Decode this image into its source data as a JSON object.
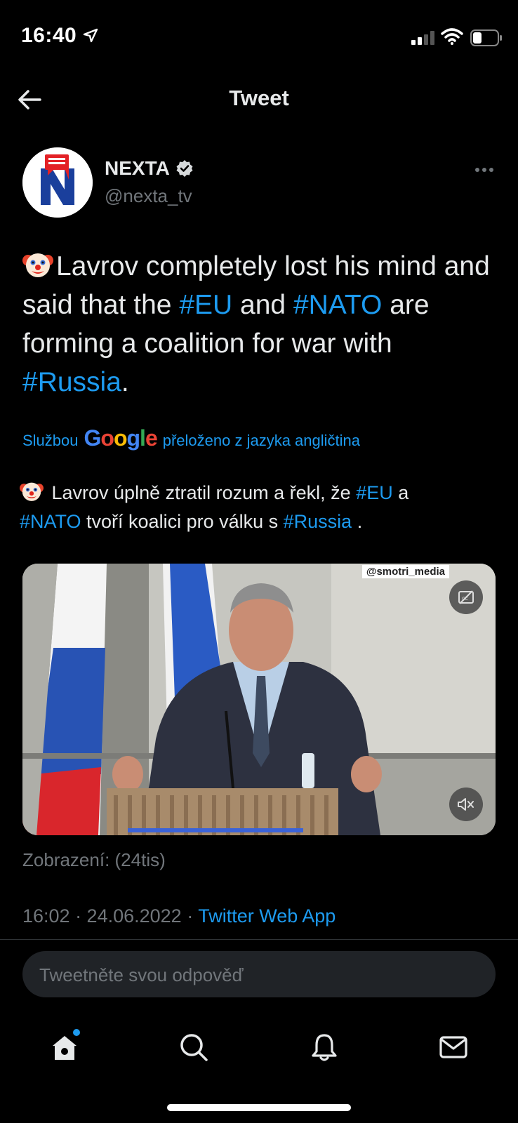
{
  "status_bar": {
    "time": "16:40"
  },
  "header": {
    "title": "Tweet"
  },
  "author": {
    "name": "NEXTA",
    "handle": "@nexta_tv"
  },
  "tweet": {
    "part1": "Lavrov completely lost his mind and said that the ",
    "tag_eu": "#EU",
    "and": " and ",
    "tag_nato": "#NATO",
    "part2": " are forming a coalition for war with ",
    "tag_russia": "#Russia",
    "end": "."
  },
  "translation": {
    "prefix": "Službou",
    "google": "Google",
    "suffix": "přeloženo z jazyka angličtina",
    "part1": " Lavrov úplně ztratil rozum a řekl, že ",
    "tag_eu": "#EU",
    "a": " a ",
    "tag_nato": "#NATO",
    "part2": " tvoří koalici pro válku s ",
    "tag_russia": "#Russia",
    "end": " ."
  },
  "media": {
    "watermark": "@smotri_media"
  },
  "views": "Zobrazení: (24tis)",
  "meta": {
    "time_date": "16:02 · 24.06.2022 · ",
    "app": "Twitter Web App"
  },
  "reply": {
    "placeholder": "Tweetněte svou odpověď"
  },
  "colors": {
    "accent": "#1d9bf0",
    "background": "#000000",
    "muted": "#71767b"
  }
}
